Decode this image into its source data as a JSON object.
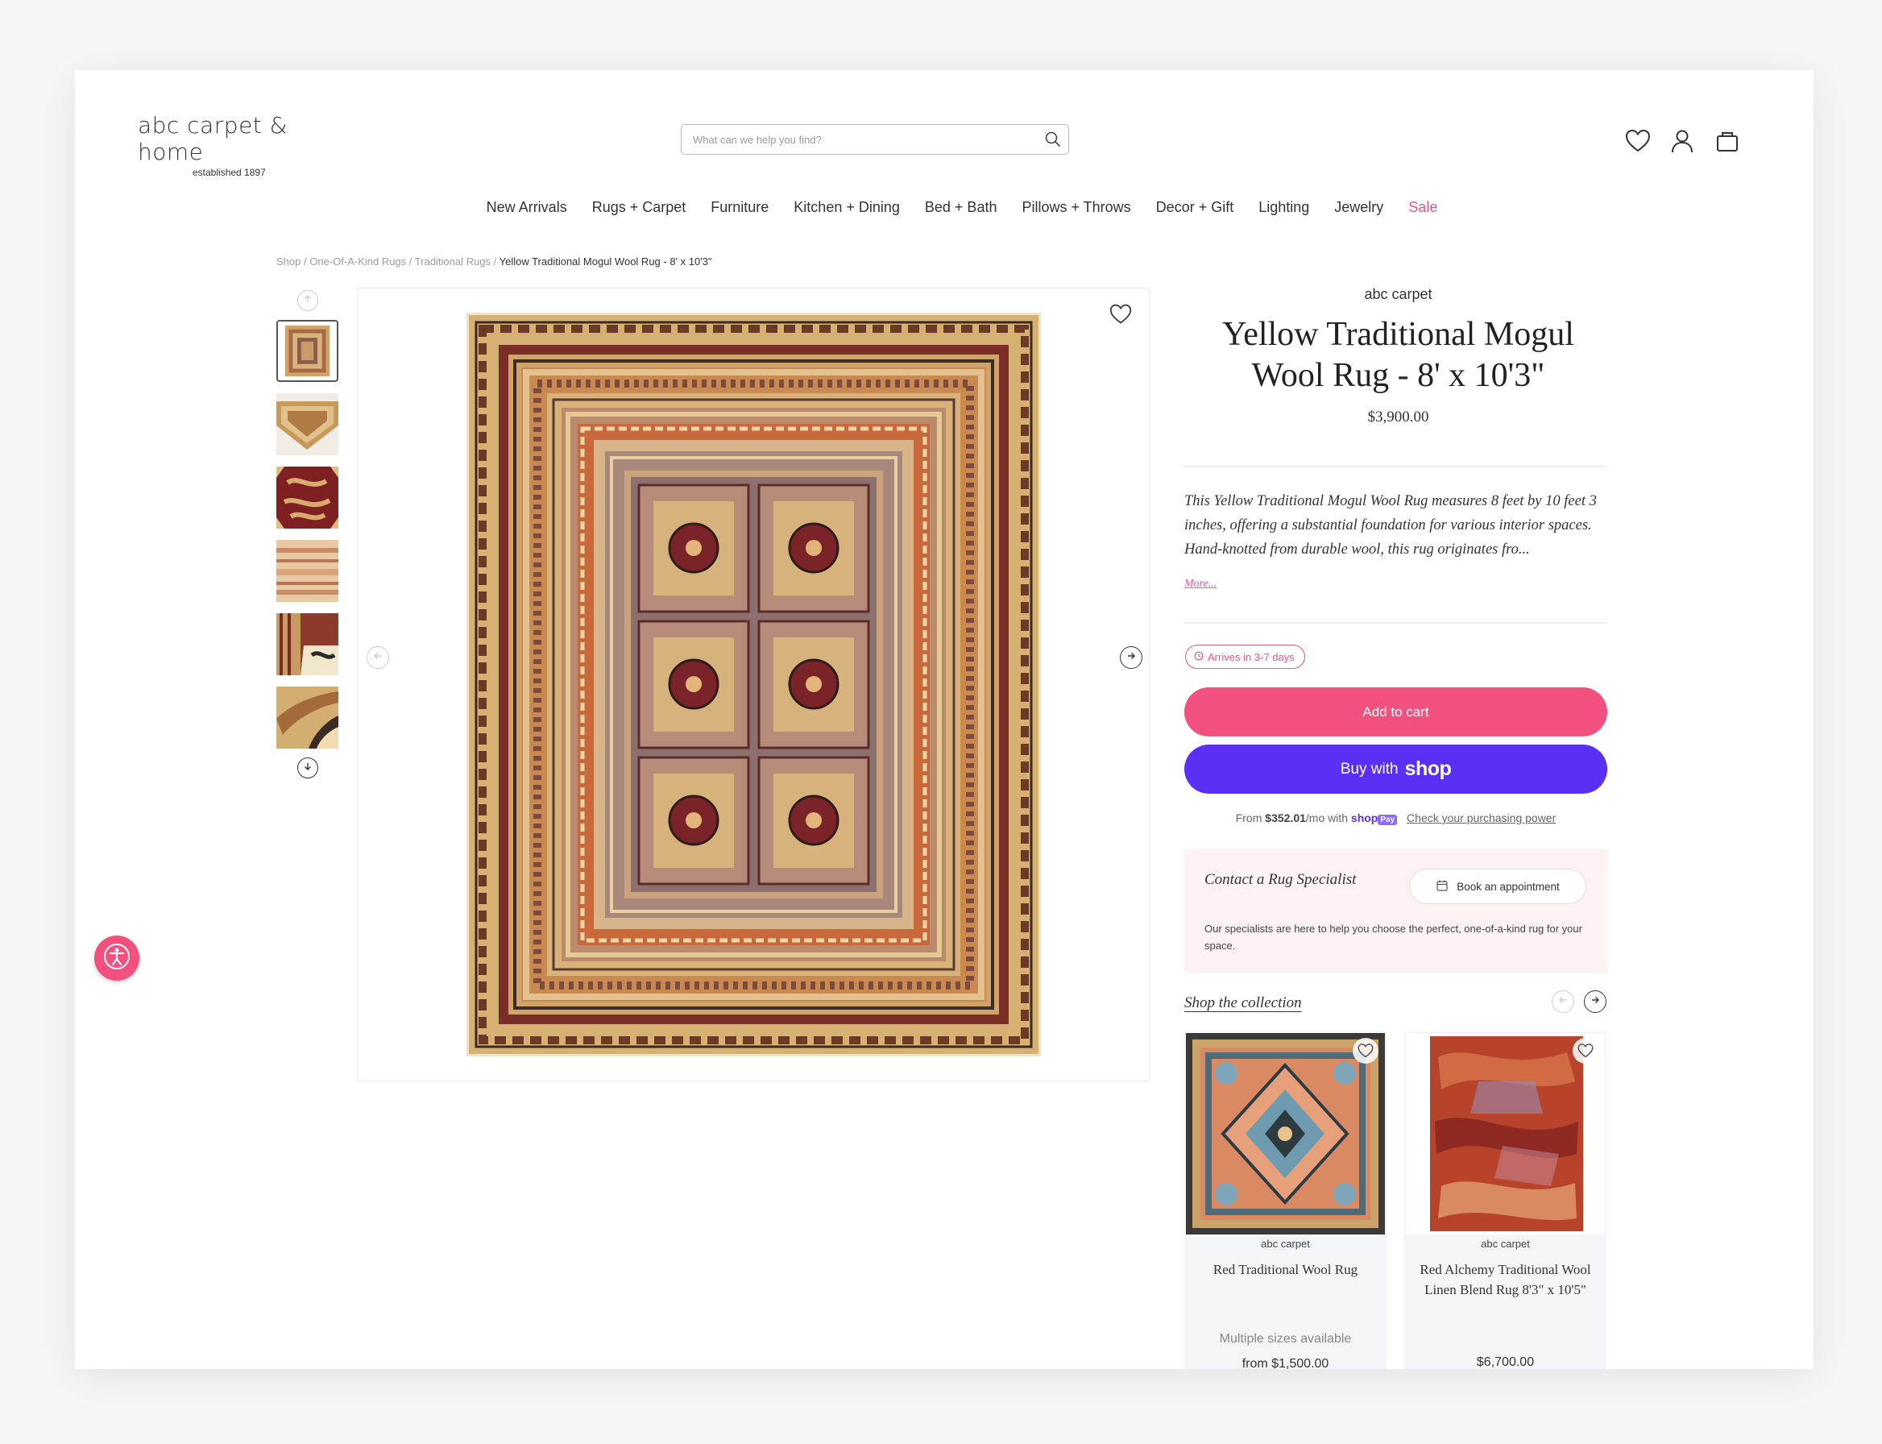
{
  "logo": {
    "name": "abc carpet & home",
    "tagline": "established 1897"
  },
  "search": {
    "placeholder": "What can we help you find?"
  },
  "nav": [
    "New Arrivals",
    "Rugs + Carpet",
    "Furniture",
    "Kitchen + Dining",
    "Bed + Bath",
    "Pillows + Throws",
    "Decor + Gift",
    "Lighting",
    "Jewelry",
    "Sale"
  ],
  "breadcrumb": {
    "items": [
      "Shop",
      "One-Of-A-Kind Rugs",
      "Traditional Rugs"
    ],
    "separator": "/",
    "current": "Yellow Traditional Mogul Wool Rug - 8' x 10'3\""
  },
  "product": {
    "brand": "abc carpet",
    "title": "Yellow Traditional Mogul Wool Rug - 8' x 10'3\"",
    "price": "$3,900.00",
    "description": "This Yellow Traditional Mogul Wool Rug measures 8 feet by 10 feet 3 inches, offering a substantial foundation for various interior spaces. Hand-knotted from durable wool, this rug originates fro...",
    "more_label": "More...",
    "arrives": "Arrives in 3-7 days",
    "add_to_cart": "Add to cart",
    "buy_with": "Buy with",
    "buy_with_brand": "shop",
    "financing": {
      "prefix": "From",
      "amount": "$352.01",
      "suffix": "/mo with",
      "brand": "shop",
      "badge": "Pay",
      "link": "Check your purchasing power"
    }
  },
  "specialist": {
    "title": "Contact a Rug Specialist",
    "button": "Book an appointment",
    "text": "Our specialists are here to help you choose the perfect, one-of-a-kind rug for your space."
  },
  "collection": {
    "title": "Shop the collection",
    "cards": [
      {
        "brand": "abc carpet",
        "name": "Red Traditional Wool Rug",
        "price": "from $1,500.00",
        "note": "Multiple sizes available"
      },
      {
        "brand": "abc carpet",
        "name": "Red Alchemy Traditional Wool Linen Blend Rug 8'3\" x 10'5\"",
        "price": "$6,700.00",
        "note": ""
      }
    ]
  },
  "colors": {
    "accent_pink": "#f2507e",
    "shop_purple": "#5a31f4",
    "rug_gold": "#d9b27a",
    "rug_rust": "#c8693c"
  },
  "icons": [
    "search-icon",
    "heart-icon",
    "account-icon",
    "bag-icon",
    "arrow-up-icon",
    "arrow-down-icon",
    "arrow-left-icon",
    "arrow-right-icon",
    "clock-icon",
    "calendar-icon",
    "accessibility-icon"
  ]
}
